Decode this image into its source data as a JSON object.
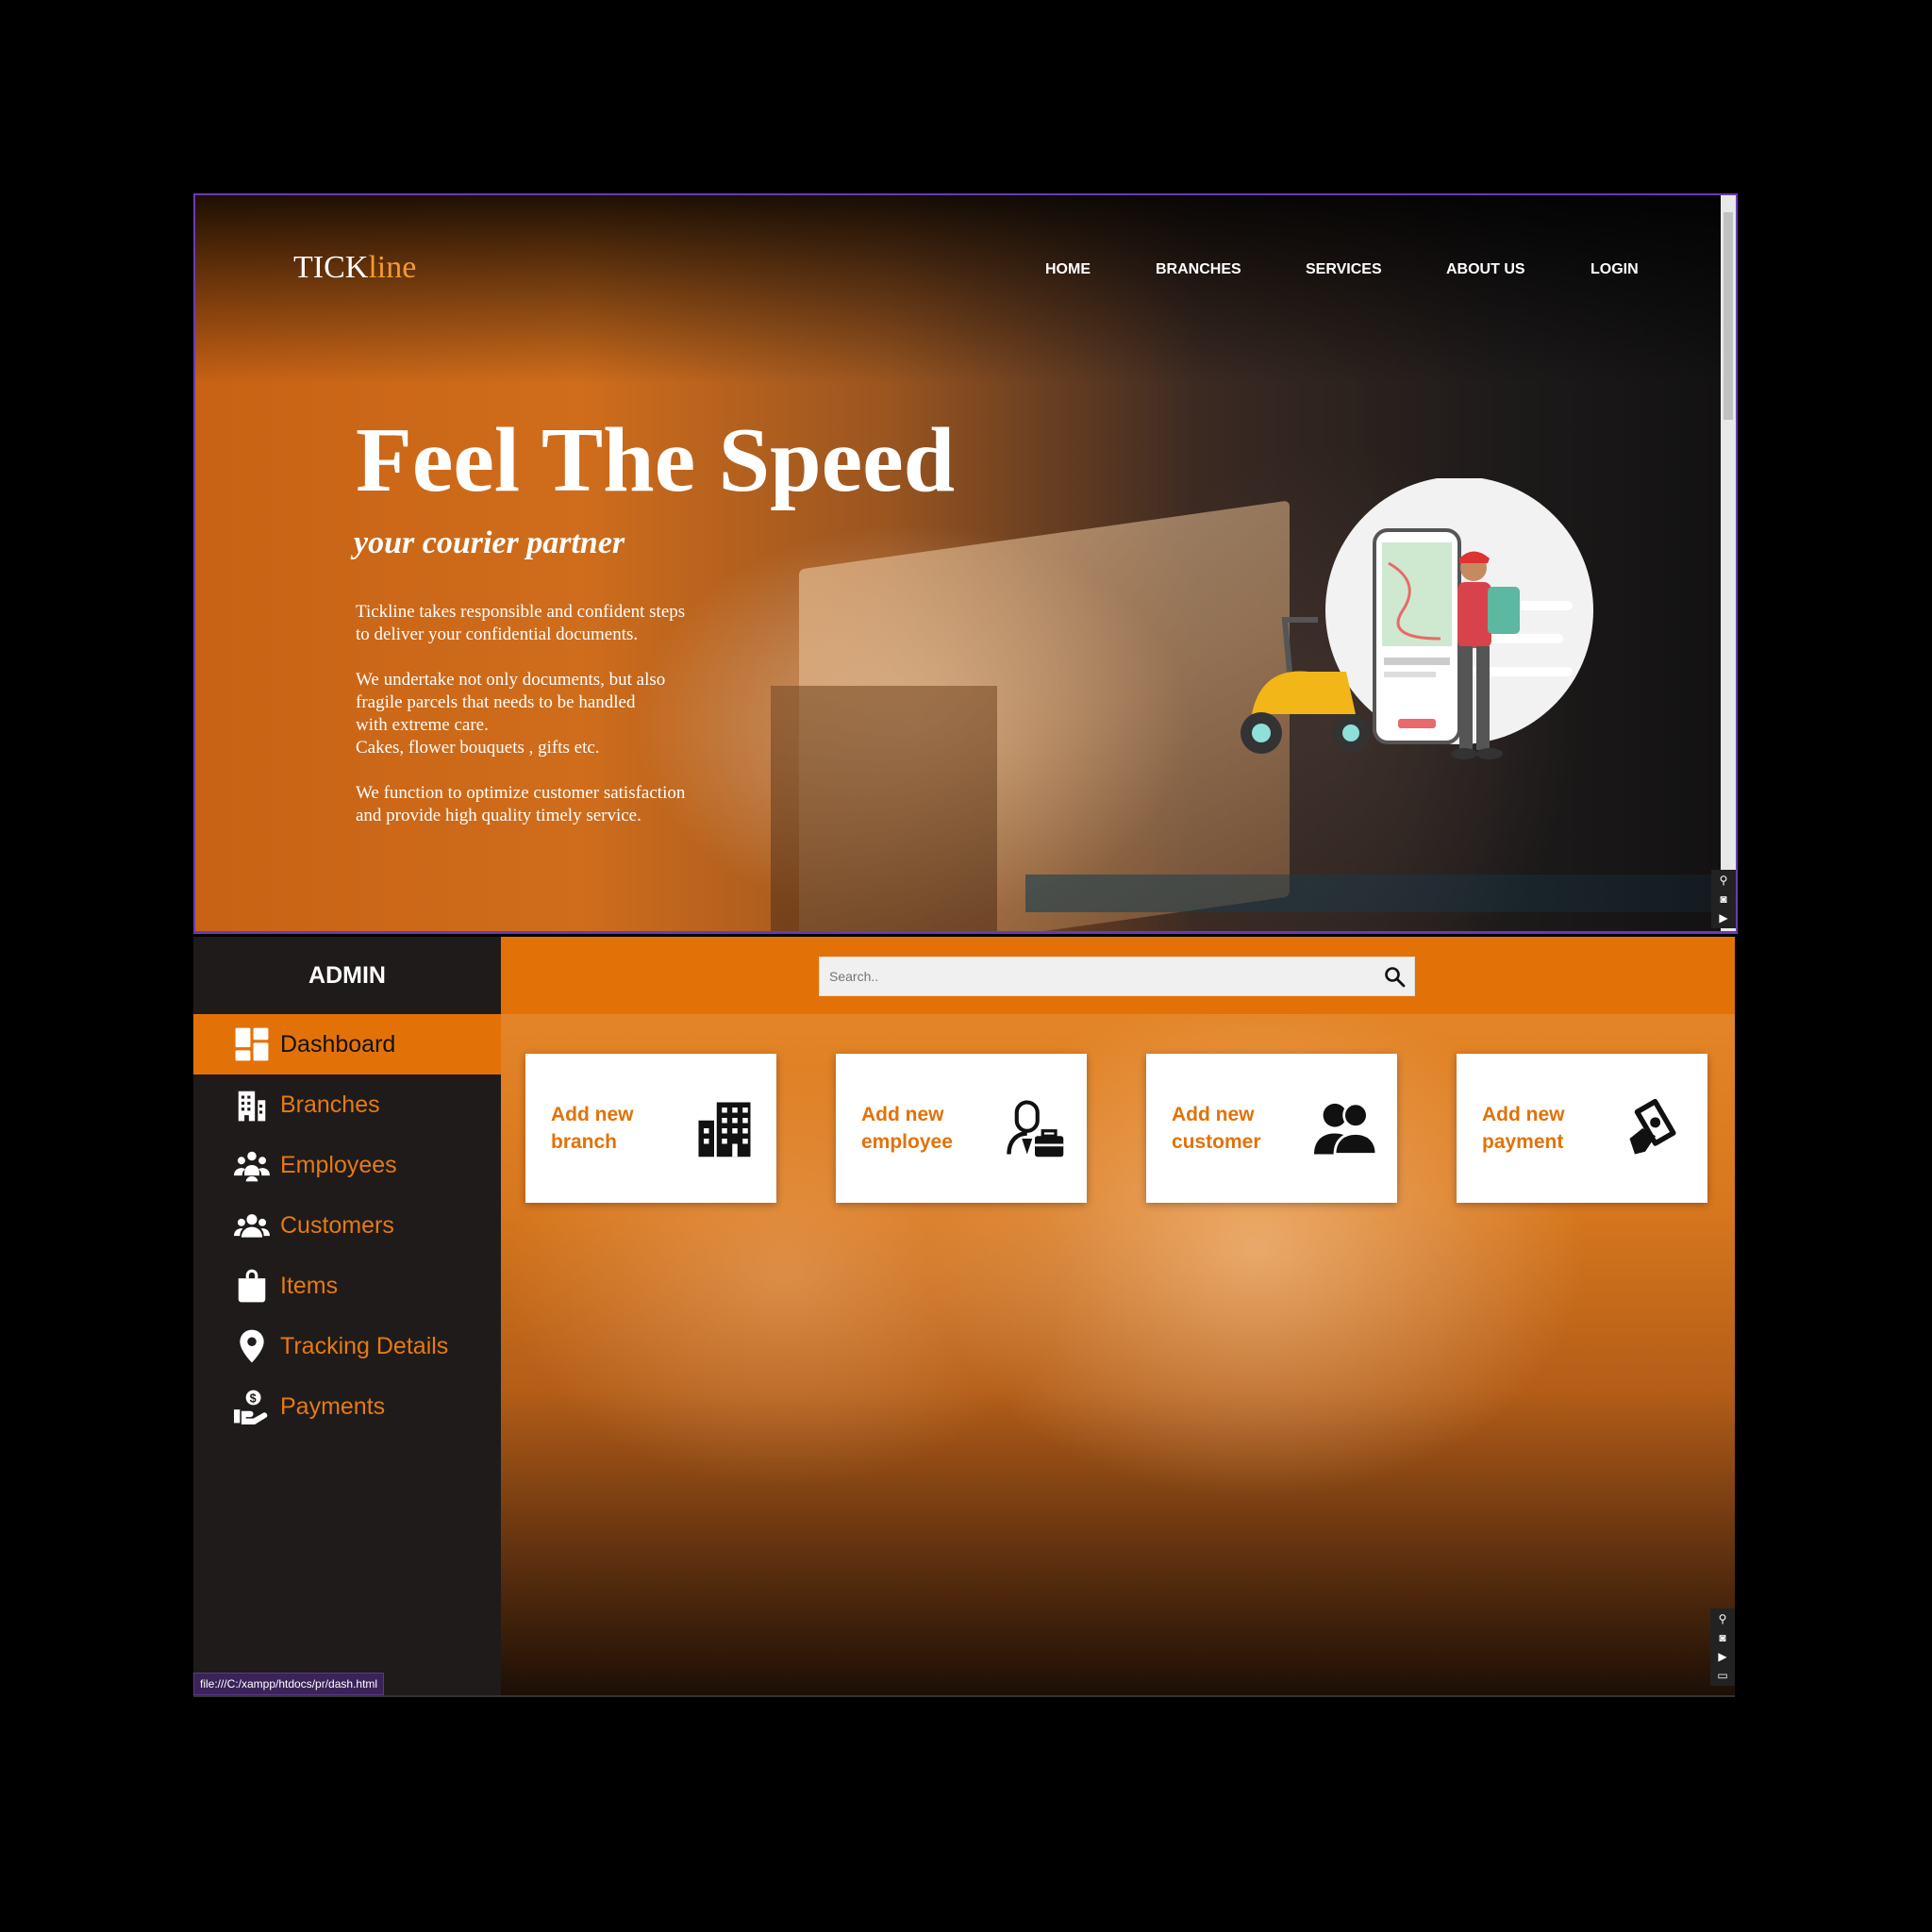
{
  "landing": {
    "logo_a": "TICK",
    "logo_b": "line",
    "nav": [
      "HOME",
      "BRANCHES",
      "SERVICES",
      "ABOUT US",
      "LOGIN"
    ],
    "hero_title": "Feel The Speed",
    "hero_subtitle": "your courier partner",
    "paragraphs": [
      "Tickline takes responsible and confident steps\nto deliver your confidential documents.",
      "We undertake not only documents, but also\nfragile parcels that needs to be handled\nwith extreme care.\nCakes, flower bouquets , gifts etc.",
      "We function to optimize customer satisfaction\nand provide high quality timely service."
    ],
    "illustration": "delivery-man-scooter-phone-map"
  },
  "admin": {
    "title": "ADMIN",
    "menu": [
      {
        "label": "Dashboard",
        "icon": "dashboard-icon",
        "active": true
      },
      {
        "label": "Branches",
        "icon": "building-icon",
        "active": false
      },
      {
        "label": "Employees",
        "icon": "group-icon",
        "active": false
      },
      {
        "label": "Customers",
        "icon": "customers-icon",
        "active": false
      },
      {
        "label": "Items",
        "icon": "bag-icon",
        "active": false
      },
      {
        "label": "Tracking Details",
        "icon": "location-pin-icon",
        "active": false
      },
      {
        "label": "Payments",
        "icon": "hand-money-icon",
        "active": false
      }
    ],
    "search_placeholder": "Search..",
    "cards": [
      {
        "label": "Add new\nbranch",
        "icon": "office-building-icon"
      },
      {
        "label": "Add new\nemployee",
        "icon": "employee-briefcase-icon"
      },
      {
        "label": "Add new\ncustomer",
        "icon": "two-people-icon"
      },
      {
        "label": "Add new\npayment",
        "icon": "cash-hand-icon"
      }
    ]
  },
  "status_url": "file:///C:/xampp/htdocs/pr/dash.html",
  "colors": {
    "accent": "#e27208",
    "sidebar": "#1f1b1a",
    "logo_accent": "#f39a2d"
  }
}
